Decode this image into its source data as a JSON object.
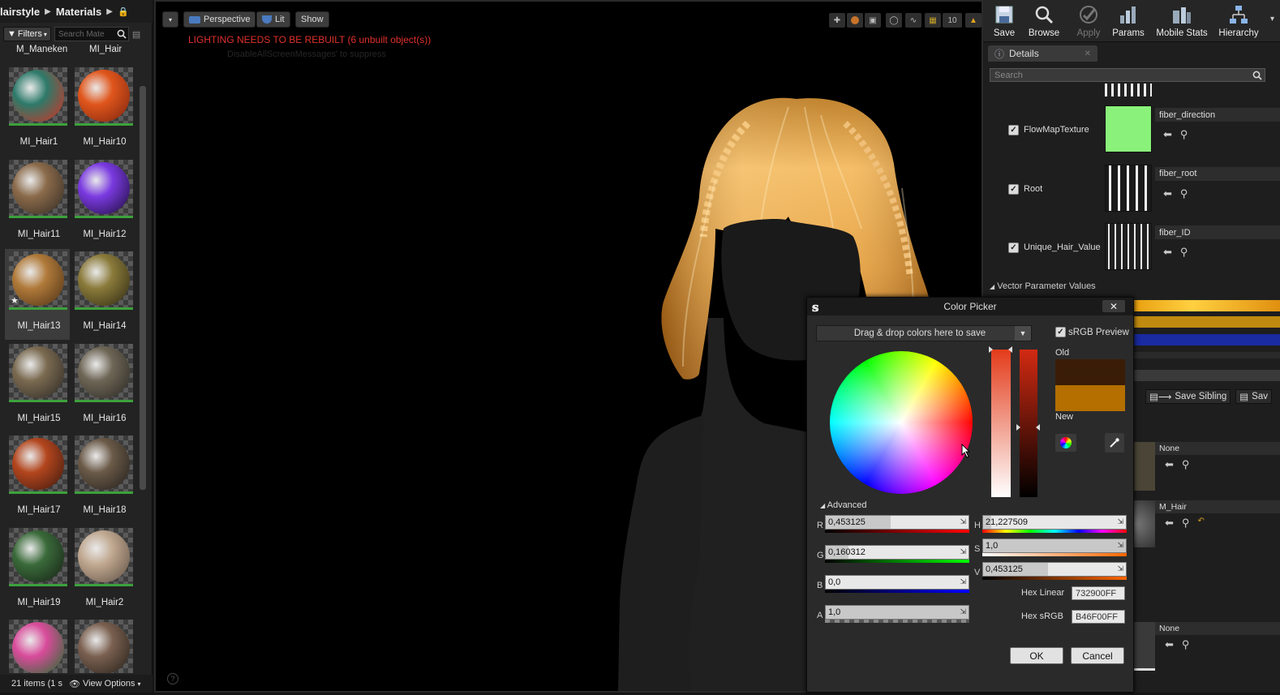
{
  "left": {
    "breadcrumb": [
      "lairstyle",
      "Materials"
    ],
    "filters_label": "Filters",
    "search_placeholder": "Search Mate",
    "top_labels": [
      "M_Maneken",
      "MI_Hair"
    ],
    "assets": [
      {
        "label": "MI_Hair1",
        "c1": "#2d7a6a",
        "c2": "#c0392b"
      },
      {
        "label": "MI_Hair10",
        "c1": "#e0561c",
        "c2": "#8a2a10"
      },
      {
        "label": "MI_Hair11",
        "c1": "#8a6a4a",
        "c2": "#3e3328"
      },
      {
        "label": "MI_Hair12",
        "c1": "#7a3ae0",
        "c2": "#2a1250"
      },
      {
        "label": "MI_Hair13",
        "c1": "#b07a3a",
        "c2": "#5a3a1a",
        "selected": true
      },
      {
        "label": "MI_Hair14",
        "c1": "#8a7a3a",
        "c2": "#3a3418"
      },
      {
        "label": "MI_Hair15",
        "c1": "#7a6a50",
        "c2": "#36302a"
      },
      {
        "label": "MI_Hair16",
        "c1": "#6e6656",
        "c2": "#33302a"
      },
      {
        "label": "MI_Hair17",
        "c1": "#b2461e",
        "c2": "#4e1e10"
      },
      {
        "label": "MI_Hair18",
        "c1": "#6a5a48",
        "c2": "#2c2620"
      },
      {
        "label": "MI_Hair19",
        "c1": "#3a6a3a",
        "c2": "#1a2a1a"
      },
      {
        "label": "MI_Hair2",
        "c1": "#c0a890",
        "c2": "#6a5a4c"
      },
      {
        "label": "",
        "c1": "#d84b9a",
        "c2": "#3a6a3a"
      },
      {
        "label": "",
        "c1": "#7a6050",
        "c2": "#302820"
      }
    ],
    "footer_count": "21 items (1 s",
    "view_options": "View Options"
  },
  "viewport": {
    "perspective": "Perspective",
    "lit": "Lit",
    "show": "Show",
    "speed": "10",
    "warning": "LIGHTING NEEDS TO BE REBUILT (6 unbuilt object(s))",
    "suppress_hint": "DisableAllScreenMessages' to suppress"
  },
  "toolbar": [
    {
      "label": "Save",
      "icon": "save-icon",
      "enabled": true
    },
    {
      "label": "Browse",
      "icon": "browse-icon",
      "enabled": true
    },
    {
      "label": "Apply",
      "icon": "apply-icon",
      "enabled": false
    },
    {
      "label": "Params",
      "icon": "params-icon",
      "enabled": true
    },
    {
      "label": "Mobile Stats",
      "icon": "mobile-stats-icon",
      "enabled": true
    },
    {
      "label": "Hierarchy",
      "icon": "hierarchy-icon",
      "enabled": true
    }
  ],
  "details": {
    "tab": "Details",
    "search_placeholder": "Search",
    "params": [
      {
        "name": "FlowMapTexture",
        "asset": "fiber_direction",
        "checked": true
      },
      {
        "name": "Root",
        "asset": "fiber_root",
        "checked": true
      },
      {
        "name": "Unique_Hair_Value",
        "asset": "fiber_ID",
        "checked": true
      }
    ],
    "vector_header": "Vector Parameter Values",
    "save_sibling": "Save Sibling",
    "save_child": "Sav",
    "lower_rows": [
      "None",
      "M_Hair",
      "None"
    ]
  },
  "color_picker": {
    "title": "Color Picker",
    "dropzone": "Drag & drop colors here to save",
    "srgb_preview": "sRGB Preview",
    "old_label": "Old",
    "new_label": "New",
    "old_color": "#3a1d06",
    "new_color": "#b46f00",
    "advanced": "Advanced",
    "rgba": [
      {
        "ch": "R",
        "value": "0,453125",
        "frac": 0.453
      },
      {
        "ch": "G",
        "value": "0,160312",
        "frac": 0.16
      },
      {
        "ch": "B",
        "value": "0,0",
        "frac": 0.0
      },
      {
        "ch": "A",
        "value": "1,0",
        "frac": 1.0
      }
    ],
    "hsv": [
      {
        "ch": "H",
        "value": "21,227509",
        "frac": 0.059
      },
      {
        "ch": "S",
        "value": "1,0",
        "frac": 1.0
      },
      {
        "ch": "V",
        "value": "0,453125",
        "frac": 0.453
      }
    ],
    "hex_linear_label": "Hex Linear",
    "hex_linear": "732900FF",
    "hex_srgb_label": "Hex sRGB",
    "hex_srgb": "B46F00FF",
    "ok": "OK",
    "cancel": "Cancel"
  }
}
